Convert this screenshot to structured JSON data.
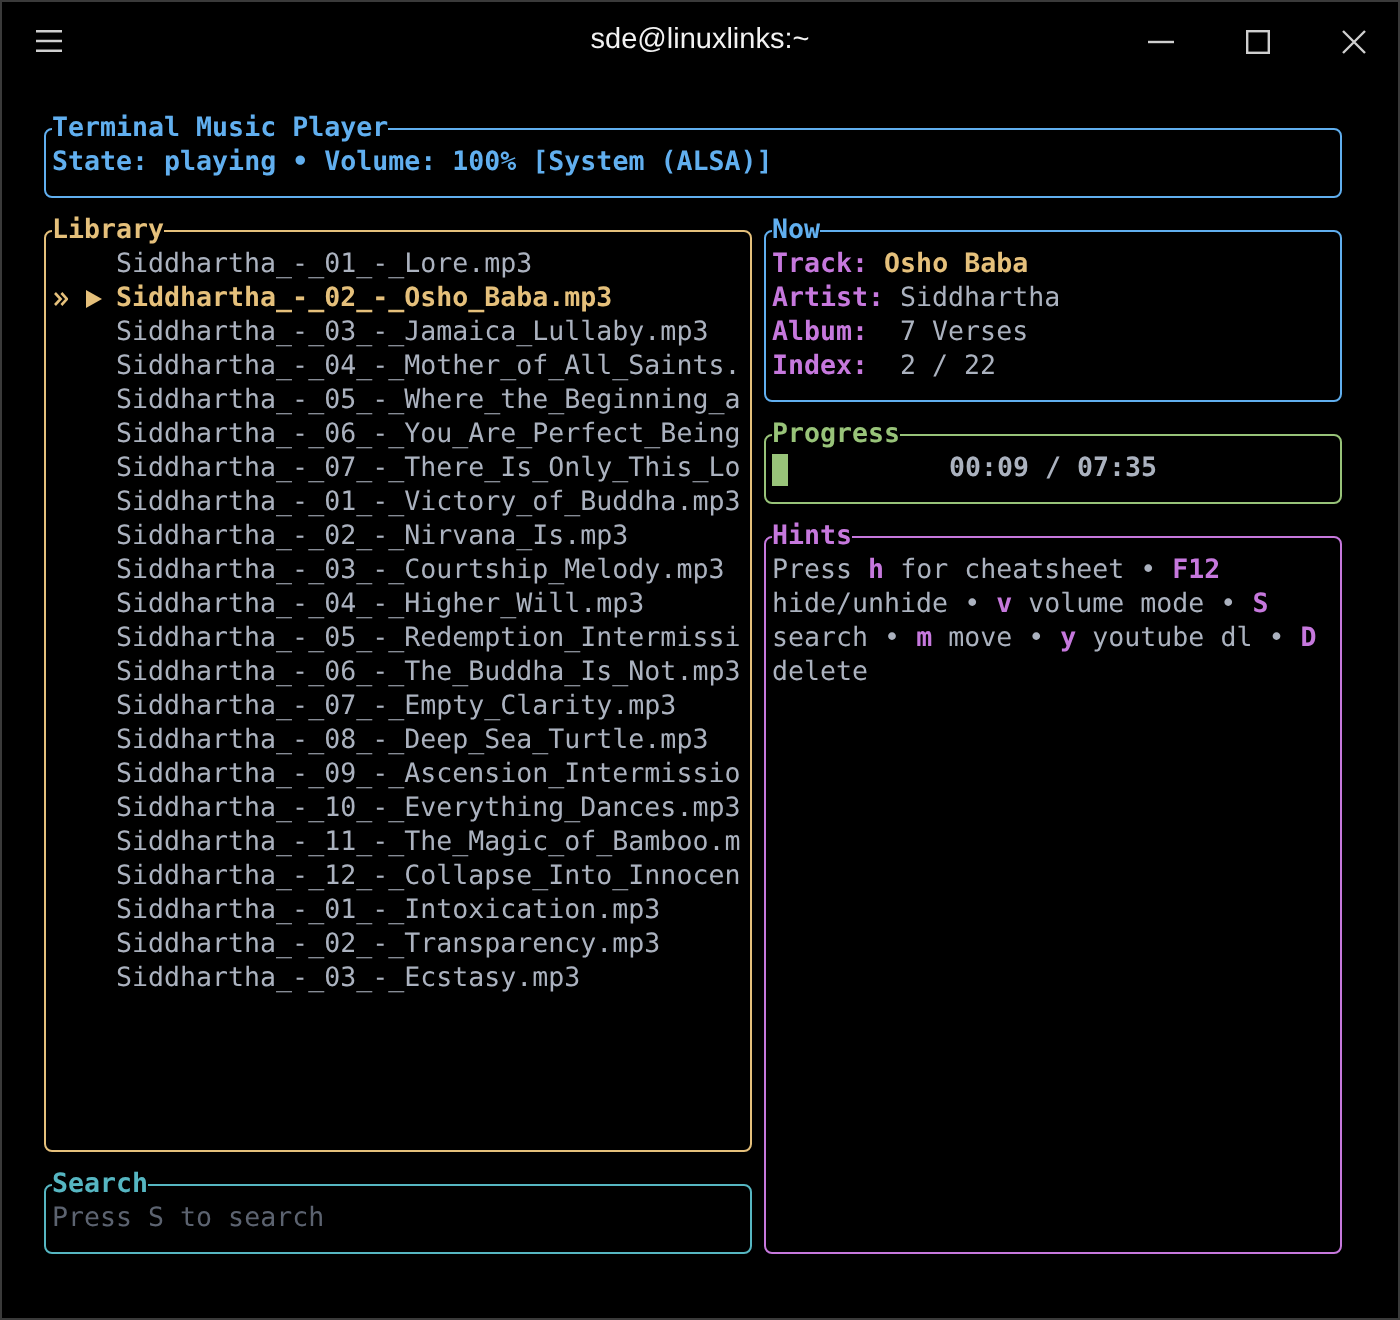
{
  "window": {
    "title": "sde@linuxlinks:~"
  },
  "header": {
    "title": "Terminal Music Player",
    "status": "State: playing • Volume: 100% [System (ALSA)]"
  },
  "library": {
    "title": "Library",
    "items": [
      {
        "name": "Siddhartha_-_01_-_Lore.mp3",
        "selected": false,
        "playing": false
      },
      {
        "name": "Siddhartha_-_02_-_Osho_Baba.mp3",
        "selected": true,
        "playing": true
      },
      {
        "name": "Siddhartha_-_03_-_Jamaica_Lullaby.mp3",
        "selected": false,
        "playing": false
      },
      {
        "name": "Siddhartha_-_04_-_Mother_of_All_Saints.",
        "selected": false,
        "playing": false
      },
      {
        "name": "Siddhartha_-_05_-_Where_the_Beginning_a",
        "selected": false,
        "playing": false
      },
      {
        "name": "Siddhartha_-_06_-_You_Are_Perfect_Being",
        "selected": false,
        "playing": false
      },
      {
        "name": "Siddhartha_-_07_-_There_Is_Only_This_Lo",
        "selected": false,
        "playing": false
      },
      {
        "name": "Siddhartha_-_01_-_Victory_of_Buddha.mp3",
        "selected": false,
        "playing": false
      },
      {
        "name": "Siddhartha_-_02_-_Nirvana_Is.mp3",
        "selected": false,
        "playing": false
      },
      {
        "name": "Siddhartha_-_03_-_Courtship_Melody.mp3",
        "selected": false,
        "playing": false
      },
      {
        "name": "Siddhartha_-_04_-_Higher_Will.mp3",
        "selected": false,
        "playing": false
      },
      {
        "name": "Siddhartha_-_05_-_Redemption_Intermissi",
        "selected": false,
        "playing": false
      },
      {
        "name": "Siddhartha_-_06_-_The_Buddha_Is_Not.mp3",
        "selected": false,
        "playing": false
      },
      {
        "name": "Siddhartha_-_07_-_Empty_Clarity.mp3",
        "selected": false,
        "playing": false
      },
      {
        "name": "Siddhartha_-_08_-_Deep_Sea_Turtle.mp3",
        "selected": false,
        "playing": false
      },
      {
        "name": "Siddhartha_-_09_-_Ascension_Intermissio",
        "selected": false,
        "playing": false
      },
      {
        "name": "Siddhartha_-_10_-_Everything_Dances.mp3",
        "selected": false,
        "playing": false
      },
      {
        "name": "Siddhartha_-_11_-_The_Magic_of_Bamboo.m",
        "selected": false,
        "playing": false
      },
      {
        "name": "Siddhartha_-_12_-_Collapse_Into_Innocen",
        "selected": false,
        "playing": false
      },
      {
        "name": "Siddhartha_-_01_-_Intoxication.mp3",
        "selected": false,
        "playing": false
      },
      {
        "name": "Siddhartha_-_02_-_Transparency.mp3",
        "selected": false,
        "playing": false
      },
      {
        "name": "Siddhartha_-_03_-_Ecstasy.mp3",
        "selected": false,
        "playing": false
      }
    ]
  },
  "now": {
    "title": "Now",
    "fields": [
      {
        "kind": "highlight",
        "label": "Track:",
        "value": "Osho Baba"
      },
      {
        "kind": "plain",
        "label": "Artist:",
        "value": "Siddhartha"
      },
      {
        "kind": "plain",
        "label": "Album:",
        "value": "7 Verses"
      },
      {
        "kind": "plain",
        "label": "Index:",
        "value": "2 / 22"
      }
    ]
  },
  "progress": {
    "title": "Progress",
    "level": 0.02,
    "time": "00:09 / 07:35"
  },
  "hints": {
    "title": "Hints",
    "text": "Press **h** for cheatsheet • **F12** hide/unhide • **v** volume mode • **S** search • **m** move • **y** youtube dl • **D** delete"
  },
  "search": {
    "title": "Search",
    "placeholder": "Press S to search"
  }
}
